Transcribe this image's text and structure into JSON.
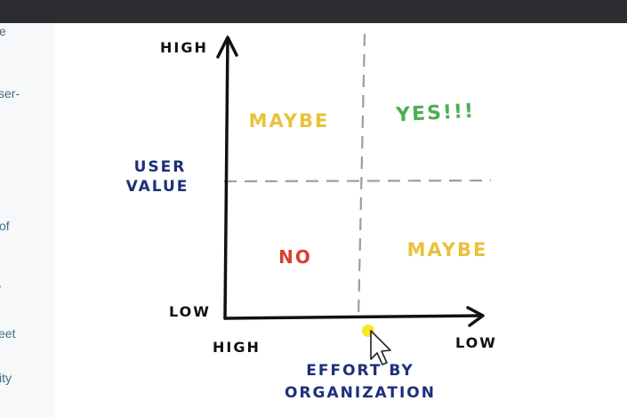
{
  "sidebar": {
    "fragments": [
      "e",
      "ser-",
      "of",
      "y",
      "eet",
      "ity"
    ]
  },
  "diagram": {
    "y_axis": {
      "high": "HIGH",
      "low": "LOW",
      "title_line1": "USER",
      "title_line2": "VALUE"
    },
    "x_axis": {
      "left": "HIGH",
      "right": "LOW",
      "title_line1": "EFFORT BY",
      "title_line2": "ORGANIZATION"
    },
    "quadrants": {
      "top_left": "MAYBE",
      "top_right": "YES!!!",
      "bottom_left": "NO",
      "bottom_right": "MAYBE"
    },
    "colors": {
      "ink": "#111111",
      "axis_title": "#1d2f7a",
      "maybe": "#e8c23a",
      "yes": "#4caf50",
      "no": "#d9412f",
      "dash": "#9e9e9e",
      "cursor_highlight": "#f5e50a"
    }
  }
}
